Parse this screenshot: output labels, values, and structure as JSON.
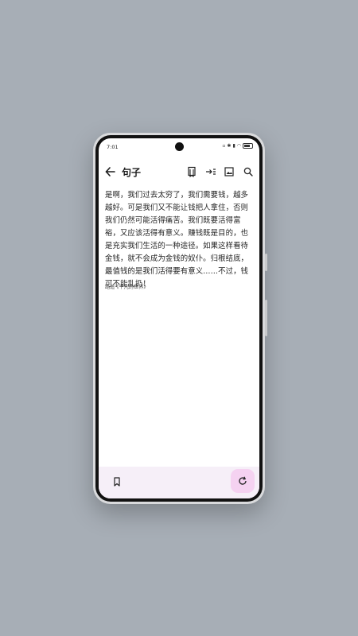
{
  "status": {
    "time": "7:01"
  },
  "appbar": {
    "title": "句子",
    "back_icon": "arrow-left-icon",
    "actions": [
      "book-icon",
      "share-icon",
      "image-icon",
      "search-icon"
    ]
  },
  "quote": {
    "text": "是啊，我们过去太穷了，我们需要钱，越多越好。可是我们又不能让钱把人拿住，否则我们仍然可能活得痛苦。我们既要活得富裕，又应该活得有意义。赚钱既是目的，也是充实我们生活的一种途径。如果这样看待金钱，就不会成为金钱的奴仆。归根结底，最值钱的是我们活得要有意义……不过，钱可不能乱扔！",
    "source": "路遥·《平凡的世界》"
  },
  "bottom": {
    "bookmark_icon": "bookmark-icon",
    "refresh_icon": "refresh-icon"
  },
  "colors": {
    "background": "#a7aeb6",
    "bottom_bar": "#f6eff8",
    "fab": "#f5d2f1"
  }
}
